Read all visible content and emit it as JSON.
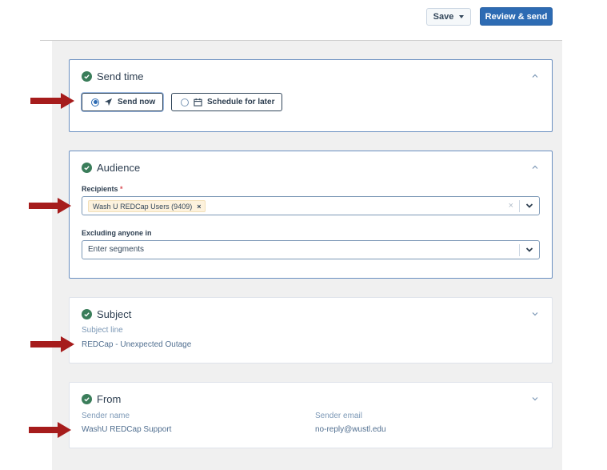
{
  "toolbar": {
    "save_label": "Save",
    "review_label": "Review & send"
  },
  "send_time": {
    "title": "Send time",
    "options": [
      "Send now",
      "Schedule for later"
    ],
    "selected": "Send now"
  },
  "audience": {
    "title": "Audience",
    "recipients_label": "Recipients",
    "required_mark": "*",
    "recipients_tag": "Wash U REDCap Users (9409)",
    "tag_remove": "×",
    "clear_symbol": "×",
    "excluding_label": "Excluding anyone in",
    "excluding_placeholder": "Enter segments"
  },
  "subject": {
    "title": "Subject",
    "line_label": "Subject line",
    "line_value": "REDCap - Unexpected Outage"
  },
  "from": {
    "title": "From",
    "sender_name_label": "Sender name",
    "sender_name_value": "WashU REDCap Support",
    "sender_email_label": "Sender email",
    "sender_email_value": "no-reply@wustl.edu"
  },
  "colors": {
    "primary": "#2d6bb3",
    "check": "#3a7d5a",
    "arrow": "#a61c1c",
    "tag_bg": "#fdf2dd"
  }
}
